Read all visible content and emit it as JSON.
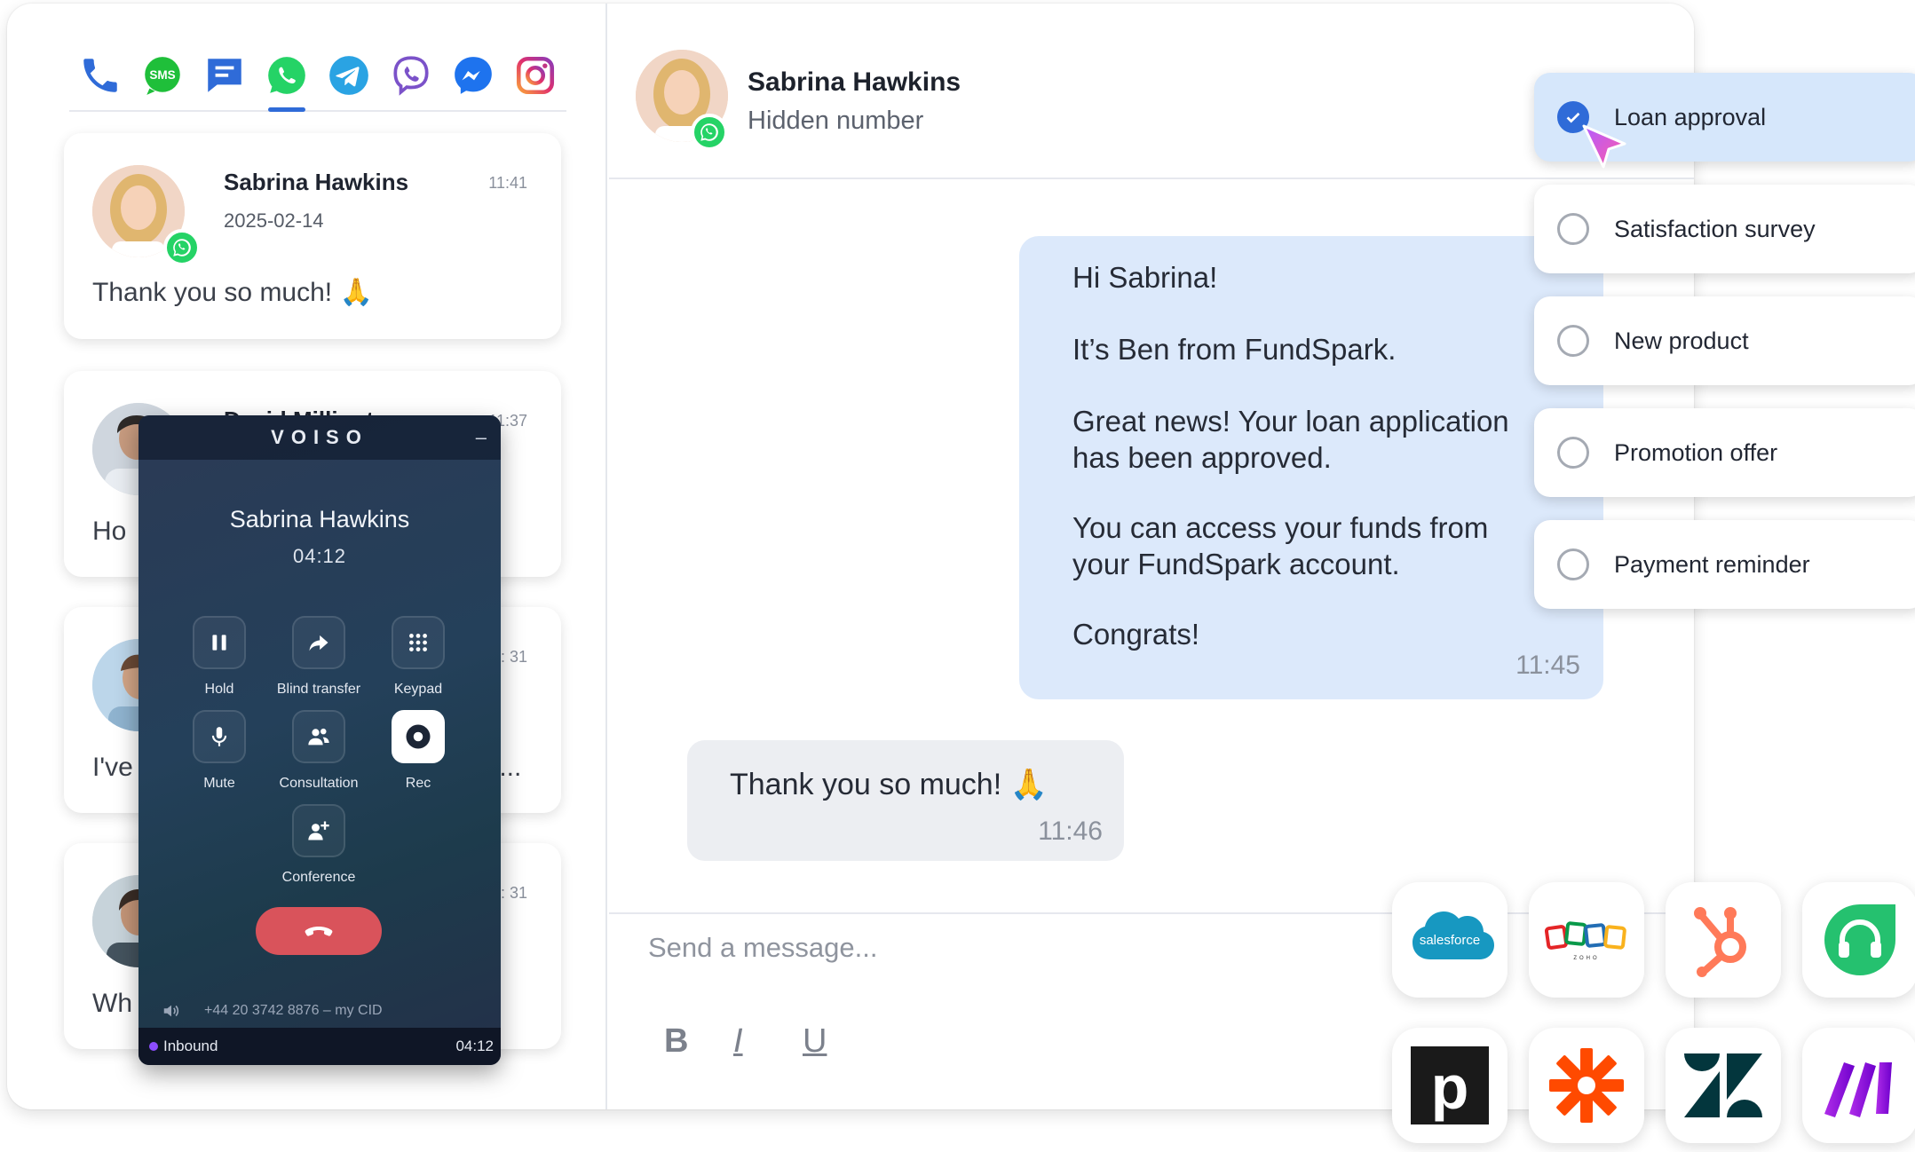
{
  "channels": [
    "phone-icon",
    "sms-icon",
    "chat-icon",
    "whatsapp-icon",
    "telegram-icon",
    "viber-icon",
    "messenger-icon",
    "instagram-icon"
  ],
  "active_channel": "whatsapp",
  "sms_label": "SMS",
  "conversations": [
    {
      "name": "Sabrina Hawkins",
      "date": "2025-02-14",
      "time": "11:41",
      "message": "Thank you so much! 🙏"
    },
    {
      "name": "David Millington",
      "time": "11:37",
      "message": "Ho"
    },
    {
      "time": "11: 31",
      "message": "I've",
      "message_tail": "t..."
    },
    {
      "time": "11: 31",
      "message": "Wh"
    }
  ],
  "widget": {
    "brand": "VOISO",
    "minimize": "–",
    "caller": "Sabrina Hawkins",
    "duration": "04:12",
    "buttons": {
      "hold": "Hold",
      "blind_transfer": "Blind transfer",
      "keypad": "Keypad",
      "mute": "Mute",
      "consultation": "Consultation",
      "rec": "Rec",
      "conference": "Conference"
    },
    "caller_id": "+44 20 3742 8876 – my CID",
    "status": "Inbound",
    "status_time": "04:12"
  },
  "chat_header": {
    "name": "Sabrina Hawkins",
    "subtitle": "Hidden number"
  },
  "messages": {
    "outgoing": {
      "p1": "Hi Sabrina!",
      "p2": "It’s Ben from FundSpark.",
      "p3": "Great news! Your loan application has been approved.",
      "p4": "You can access your funds from your FundSpark account.",
      "p5": "Congrats!",
      "time": "11:45"
    },
    "incoming": {
      "text": "Thank you so much! 🙏",
      "time": "11:46"
    }
  },
  "composer": {
    "placeholder": "Send a message...",
    "bold": "B",
    "italic": "I",
    "underline": "U"
  },
  "templates": [
    {
      "label": "Loan approval",
      "selected": true
    },
    {
      "label": "Satisfaction survey",
      "selected": false
    },
    {
      "label": "New product",
      "selected": false
    },
    {
      "label": "Promotion offer",
      "selected": false
    },
    {
      "label": "Payment reminder",
      "selected": false
    }
  ],
  "integrations": [
    "salesforce",
    "zoho",
    "hubspot",
    "freshdesk",
    "pipedrive",
    "zapier",
    "zendesk",
    "make"
  ],
  "integration_text": {
    "salesforce": "salesforce",
    "zoho": "ZOHO",
    "pipedrive": "p"
  },
  "colors": {
    "accent": "#2f6bd8",
    "whatsapp": "#25d366",
    "selected_bg": "#d6e7fb",
    "outgoing_bubble": "#dce9fb",
    "hangup": "#d9535b"
  }
}
